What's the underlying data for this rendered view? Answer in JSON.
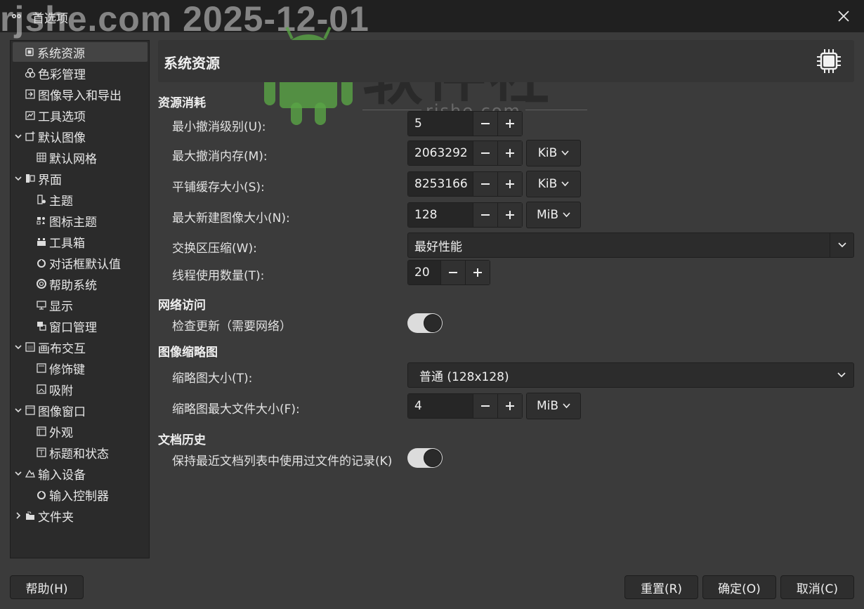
{
  "window": {
    "title": "首选项",
    "app_icon_label": "GIMP"
  },
  "watermark": {
    "top": "rjshe.com 2025-12-01",
    "brand": "软件社",
    "site": "rjshe.com"
  },
  "sidebar": {
    "items": [
      {
        "label": "系统资源",
        "icon": "chip-icon",
        "expander": "none",
        "level": 0,
        "selected": true
      },
      {
        "label": "色彩管理",
        "icon": "color-circles-icon",
        "expander": "none",
        "level": 0
      },
      {
        "label": "图像导入和导出",
        "icon": "import-export-icon",
        "expander": "none",
        "level": 0
      },
      {
        "label": "工具选项",
        "icon": "tool-options-icon",
        "expander": "none",
        "level": 0
      },
      {
        "label": "默认图像",
        "icon": "new-image-icon",
        "expander": "expanded",
        "level": 0
      },
      {
        "label": "默认网格",
        "icon": "grid-icon",
        "expander": "none",
        "level": 1
      },
      {
        "label": "界面",
        "icon": "interface-icon",
        "expander": "expanded",
        "level": 0
      },
      {
        "label": "主题",
        "icon": "theme-icon",
        "expander": "none",
        "level": 1
      },
      {
        "label": "图标主题",
        "icon": "icon-theme-icon",
        "expander": "none",
        "level": 1
      },
      {
        "label": "工具箱",
        "icon": "toolbox-icon",
        "expander": "none",
        "level": 1
      },
      {
        "label": "对话框默认值",
        "icon": "dialog-defaults-icon",
        "expander": "none",
        "level": 1
      },
      {
        "label": "帮助系统",
        "icon": "help-lifebuoy-icon",
        "expander": "none",
        "level": 1
      },
      {
        "label": "显示",
        "icon": "display-icon",
        "expander": "none",
        "level": 1
      },
      {
        "label": "窗口管理",
        "icon": "window-management-icon",
        "expander": "none",
        "level": 1
      },
      {
        "label": "画布交互",
        "icon": "canvas-icon",
        "expander": "expanded",
        "level": 0
      },
      {
        "label": "修饰键",
        "icon": "modifier-keys-icon",
        "expander": "none",
        "level": 1
      },
      {
        "label": "吸附",
        "icon": "snap-icon",
        "expander": "none",
        "level": 1
      },
      {
        "label": "图像窗口",
        "icon": "image-window-icon",
        "expander": "expanded",
        "level": 0
      },
      {
        "label": "外观",
        "icon": "appearance-icon",
        "expander": "none",
        "level": 1
      },
      {
        "label": "标题和状态",
        "icon": "title-status-icon",
        "expander": "none",
        "level": 1
      },
      {
        "label": "输入设备",
        "icon": "input-devices-icon",
        "expander": "expanded",
        "level": 0
      },
      {
        "label": "输入控制器",
        "icon": "input-controller-icon",
        "expander": "none",
        "level": 1
      },
      {
        "label": "文件夹",
        "icon": "folders-icon",
        "expander": "collapsed",
        "level": 0
      }
    ]
  },
  "page": {
    "title": "系统资源",
    "icon": "chip-icon"
  },
  "sections": {
    "resource": {
      "title": "资源消耗",
      "min_undo_label": "最小撤消级别(U):",
      "min_undo_value": "5",
      "max_undo_mem_label": "最大撤消内存(M):",
      "max_undo_mem_value": "2063292",
      "max_undo_mem_unit": "KiB",
      "tile_cache_label": "平铺缓存大小(S):",
      "tile_cache_value": "8253166",
      "tile_cache_unit": "KiB",
      "max_new_image_label": "最大新建图像大小(N):",
      "max_new_image_value": "128",
      "max_new_image_unit": "MiB",
      "swap_compression_label": "交换区压缩(W):",
      "swap_compression_value": "最好性能",
      "threads_label": "线程使用数量(T):",
      "threads_value": "20"
    },
    "network": {
      "title": "网络访问",
      "check_updates_label": "检查更新（需要网络）",
      "check_updates_on": true
    },
    "thumbnails": {
      "title": "图像缩略图",
      "size_label": "缩略图大小(T):",
      "size_value": "普通 (128x128)",
      "max_file_size_label": "缩略图最大文件大小(F):",
      "max_file_size_value": "4",
      "max_file_size_unit": "MiB"
    },
    "history": {
      "title": "文档历史",
      "keep_recent_label": "保持最近文档列表中使用过文件的记录(K)",
      "keep_recent_on": true
    }
  },
  "buttons": {
    "help": "帮助(H)",
    "reset": "重置(R)",
    "ok": "确定(O)",
    "cancel": "取消(C)"
  },
  "colors": {
    "window_bg": "#3b3b3b",
    "titlebar_bg": "#202020",
    "sidebar_bg": "#2b2b2b",
    "toggle_track": "#dcdcdc"
  }
}
